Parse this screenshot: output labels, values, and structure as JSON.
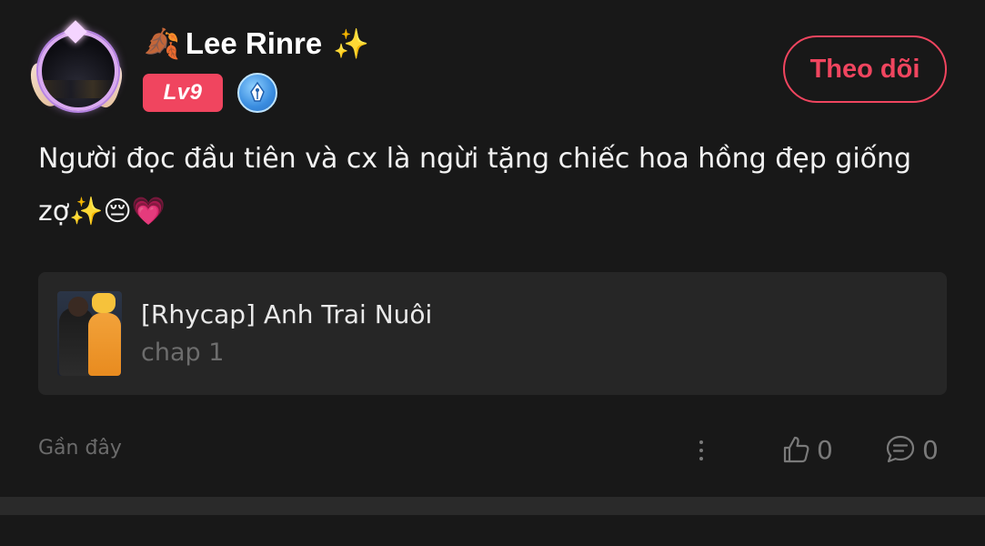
{
  "user": {
    "name": "Lee Rinre",
    "name_prefix_emoji": "🍂",
    "name_suffix_emoji": "✨",
    "level": "Lv9",
    "badge_icon": "pen-nib-icon"
  },
  "follow_label": "Theo dõi",
  "comment": {
    "text": "Người đọc đầu tiên và cx là ngừi tặng chiếc hoa hồng đẹp giống zợ✨😔💗"
  },
  "story": {
    "title": "[Rhycap] Anh Trai Nuôi",
    "chapter": "chap 1"
  },
  "footer": {
    "time": "Gần đây",
    "like_count": "0",
    "comment_count": "0"
  },
  "colors": {
    "accent": "#f0455f",
    "background": "#181818",
    "card": "#262626",
    "muted": "#6b6b6b"
  }
}
